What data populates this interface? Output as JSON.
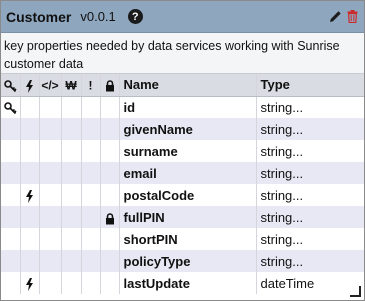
{
  "header": {
    "title": "Customer",
    "version": "v0.0.1",
    "help_icon": "?",
    "edit_icon": "pencil-icon",
    "delete_icon": "trash-icon",
    "colors": {
      "header_bg": "#8fa6bf",
      "delete": "#cc2b2b"
    }
  },
  "description": "key properties needed by data services working with Sunrise customer data",
  "columns": {
    "key": "key-icon",
    "event": "lightning-icon",
    "code": "</>",
    "currency": "₩",
    "required": "!",
    "locked": "lock-icon",
    "name": "Name",
    "type": "Type"
  },
  "rows": [
    {
      "name": "id",
      "type": "string...",
      "key": true,
      "event": false,
      "locked": false
    },
    {
      "name": "givenName",
      "type": "string...",
      "key": false,
      "event": false,
      "locked": false
    },
    {
      "name": "surname",
      "type": "string...",
      "key": false,
      "event": false,
      "locked": false
    },
    {
      "name": "email",
      "type": "string...",
      "key": false,
      "event": false,
      "locked": false
    },
    {
      "name": "postalCode",
      "type": "string...",
      "key": false,
      "event": true,
      "locked": false
    },
    {
      "name": "fullPIN",
      "type": "string...",
      "key": false,
      "event": false,
      "locked": true
    },
    {
      "name": "shortPIN",
      "type": "string...",
      "key": false,
      "event": false,
      "locked": false
    },
    {
      "name": "policyType",
      "type": "string...",
      "key": false,
      "event": false,
      "locked": false
    },
    {
      "name": "lastUpdate",
      "type": "dateTime",
      "key": false,
      "event": true,
      "locked": false
    }
  ]
}
